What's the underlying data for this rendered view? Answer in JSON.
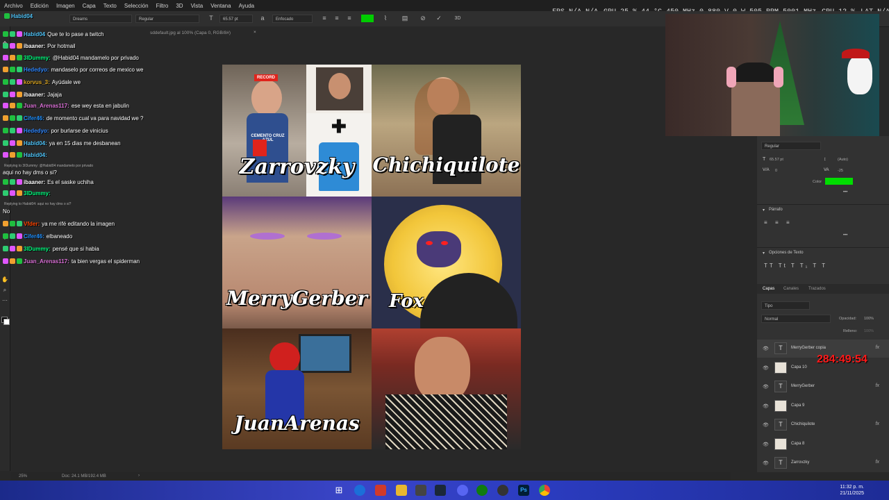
{
  "menu": [
    "Archivo",
    "Edición",
    "Imagen",
    "Capa",
    "Texto",
    "Selección",
    "Filtro",
    "3D",
    "Vista",
    "Ventana",
    "Ayuda"
  ],
  "overlay_stats": {
    "fps": "FPS N/A N/A",
    "gpu": "GPU 25 % 44 °C 450 MHz 0.880 V 0 W 505 RPM 5001 MHz",
    "cpu": "CPU 12 %",
    "lat": "LAT N/A N/A"
  },
  "options_bar": {
    "font_family": "Dreams",
    "font_style": "Regular",
    "font_size": "65.57 pt",
    "antialias": "Enfocado",
    "text_color": "#00cc00"
  },
  "doc_tabs": [
    "sddefault.jpg al 100% (Capa 0, RGB/8#)"
  ],
  "canvas_captions": {
    "c1": "Zarrovzky",
    "c2": "Chichiquilote",
    "c3": "MerryGerber",
    "c4": "Fox",
    "c5": "JuanArenas",
    "record": "RECORD",
    "jersey": "CEMENTO CRUZ AZUL"
  },
  "chat": [
    {
      "user": "Habid04",
      "color": "#4fc3f7",
      "text": "Que te lo pase a twitch"
    },
    {
      "user": "ibaaner:",
      "color": "#ffffff",
      "text": "Por hotmail"
    },
    {
      "user": "3IDummy:",
      "color": "#00ff7f",
      "text": "@Habid04 mandamelo por privado"
    },
    {
      "user": "Hededyo:",
      "color": "#2e86ff",
      "text": "mandaselo por correos de mexico we"
    },
    {
      "user": "korvus_3:",
      "color": "#daa520",
      "text": "Ayúdale we"
    },
    {
      "user": "ibaaner:",
      "color": "#ffffff",
      "text": "Jajaja"
    },
    {
      "user": "Juan_Arenas117:",
      "color": "#da70d6",
      "text": "ese wey esta en jabulin"
    },
    {
      "user": "Cifer46:",
      "color": "#1e90ff",
      "text": "de momento cual va para navidad we ?"
    },
    {
      "user": "Hededyo:",
      "color": "#2e86ff",
      "text": "por burlarse de vinicius"
    },
    {
      "user": "Habid04:",
      "color": "#4fc3f7",
      "text": "ya en 15 dias me desbanean"
    },
    {
      "user": "Habid04:",
      "color": "#4fc3f7",
      "text": ""
    },
    {
      "user": "",
      "color": "#ffffff",
      "text": "aqui no hay dms o si?"
    },
    {
      "user": "ibaaner:",
      "color": "#ffffff",
      "text": "Es el saske uchiha"
    },
    {
      "user": "3IDummy:",
      "color": "#00ff7f",
      "text": ""
    },
    {
      "user": "",
      "color": "#ffffff",
      "text": "No"
    },
    {
      "user": "Vfder:",
      "color": "#ff4500",
      "text": "ya me rifé editando la imagen"
    },
    {
      "user": "Cifer46:",
      "color": "#1e90ff",
      "text": "elbaneado"
    },
    {
      "user": "3IDummy:",
      "color": "#00ff7f",
      "text": "pensé que si habia"
    },
    {
      "user": "Juan_Arenas117:",
      "color": "#da70d6",
      "text": "ta bien vergas el spiderman"
    }
  ],
  "chat_reply_notes": {
    "r1": "Replying to 3IDummy: @Habid04 mandamelo por privado",
    "r2": "Replying to Habid04: aqui no hay dms o si?"
  },
  "chat_header_user": "Habid04",
  "right_panel": {
    "font_style": "Regular",
    "size": "65.57 pt",
    "leading": "(Auto)",
    "kerning": "0",
    "tracking": "-25",
    "color_label": "Color",
    "color": "#00dd00",
    "paragraph_title": "Párrafo",
    "text_options_title": "Opciones de Texto",
    "tabs": [
      "Capas",
      "Canales",
      "Trazados"
    ],
    "search_placeholder": "Tipo",
    "blend_mode": "Normal",
    "opacity_label": "Opacidad:",
    "opacity": "100%",
    "fill_label": "Relleno:",
    "fill": "100%",
    "layers": [
      {
        "name": "MerryGerber copia",
        "type": "text",
        "fx": true
      },
      {
        "name": "Capa 10",
        "type": "image",
        "fx": false
      },
      {
        "name": "MerryGerber",
        "type": "text",
        "fx": true
      },
      {
        "name": "Capa 9",
        "type": "image",
        "fx": false
      },
      {
        "name": "Chichiquilote",
        "type": "text",
        "fx": true
      },
      {
        "name": "Capa 8",
        "type": "image",
        "fx": false
      },
      {
        "name": "Zarrovzky",
        "type": "text",
        "fx": true
      }
    ]
  },
  "timer": "284:49:54",
  "status_bar": {
    "zoom": "25%",
    "doc": "Doc: 24.1 MB/192.4 MB"
  },
  "clock": {
    "time": "11:32 p. m.",
    "date": "21/11/2025"
  }
}
